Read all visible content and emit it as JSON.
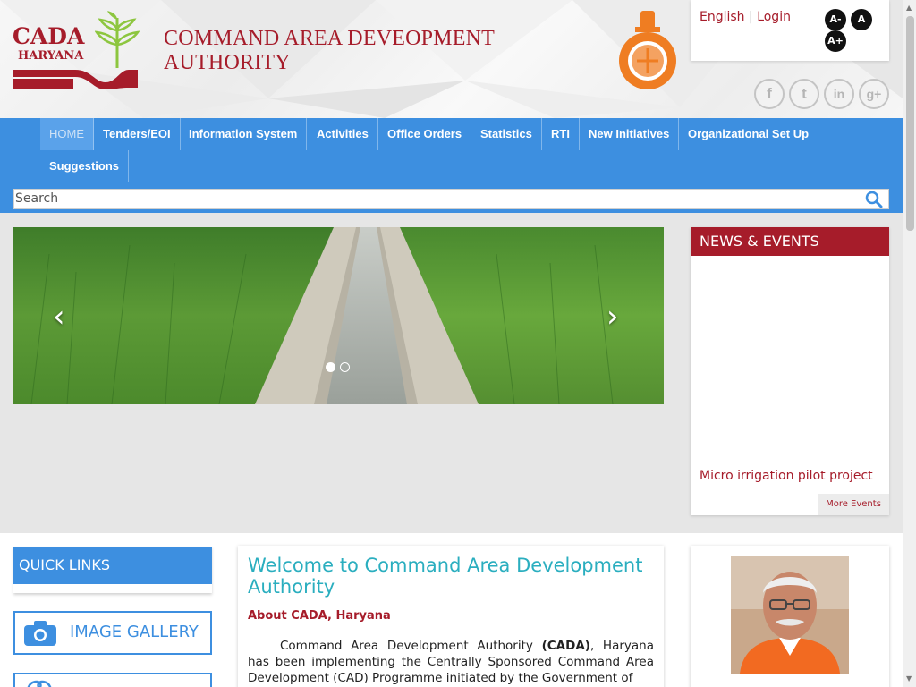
{
  "logo": {
    "line1": "CADA",
    "line2": "HARYANA"
  },
  "site_title": {
    "line1": "COMMAND AREA DEVEOPMENT",
    "line2": "AUTHORITY"
  },
  "utility": {
    "language": "English",
    "separator": "|",
    "login": "Login",
    "font_decrease": "A-",
    "font_normal": "A",
    "font_increase": "A+"
  },
  "social": [
    {
      "icon": "facebook-icon",
      "glyph": "f"
    },
    {
      "icon": "twitter-icon",
      "glyph": "t"
    },
    {
      "icon": "linkedin-icon",
      "glyph": "in"
    },
    {
      "icon": "google-plus-icon",
      "glyph": "g+"
    }
  ],
  "nav": {
    "items": [
      "HOME",
      "Tenders/EOI",
      "Information System",
      "Activities",
      "Office Orders",
      "Statistics",
      "RTI",
      "New Initiatives",
      "Organizational Set Up",
      "Suggestions"
    ],
    "active": "HOME"
  },
  "search": {
    "placeholder": "Search"
  },
  "slider": {
    "prev": "‹",
    "next": "›",
    "slides": 2,
    "current": 1
  },
  "news": {
    "title": "NEWS & EVENTS",
    "items": [
      "Micro irrigation pilot project"
    ],
    "more": "More Events"
  },
  "quick_links": {
    "title": "QUICK LINKS",
    "image_gallery": "IMAGE GALLERY"
  },
  "welcome": {
    "title": "Welcome to Command Area Development Authority",
    "subtitle": "About CADA, Haryana",
    "para_start": "Command Area Development Authority ",
    "para_bold": "(CADA)",
    "para_rest": ", Haryana has been implementing the Centrally Sponsored Command Area Development (CAD) Programme initiated by the Government of"
  },
  "colors": {
    "brand_red": "#a61c2a",
    "nav_blue": "#3d8fe0",
    "title_teal": "#2aaebf"
  }
}
